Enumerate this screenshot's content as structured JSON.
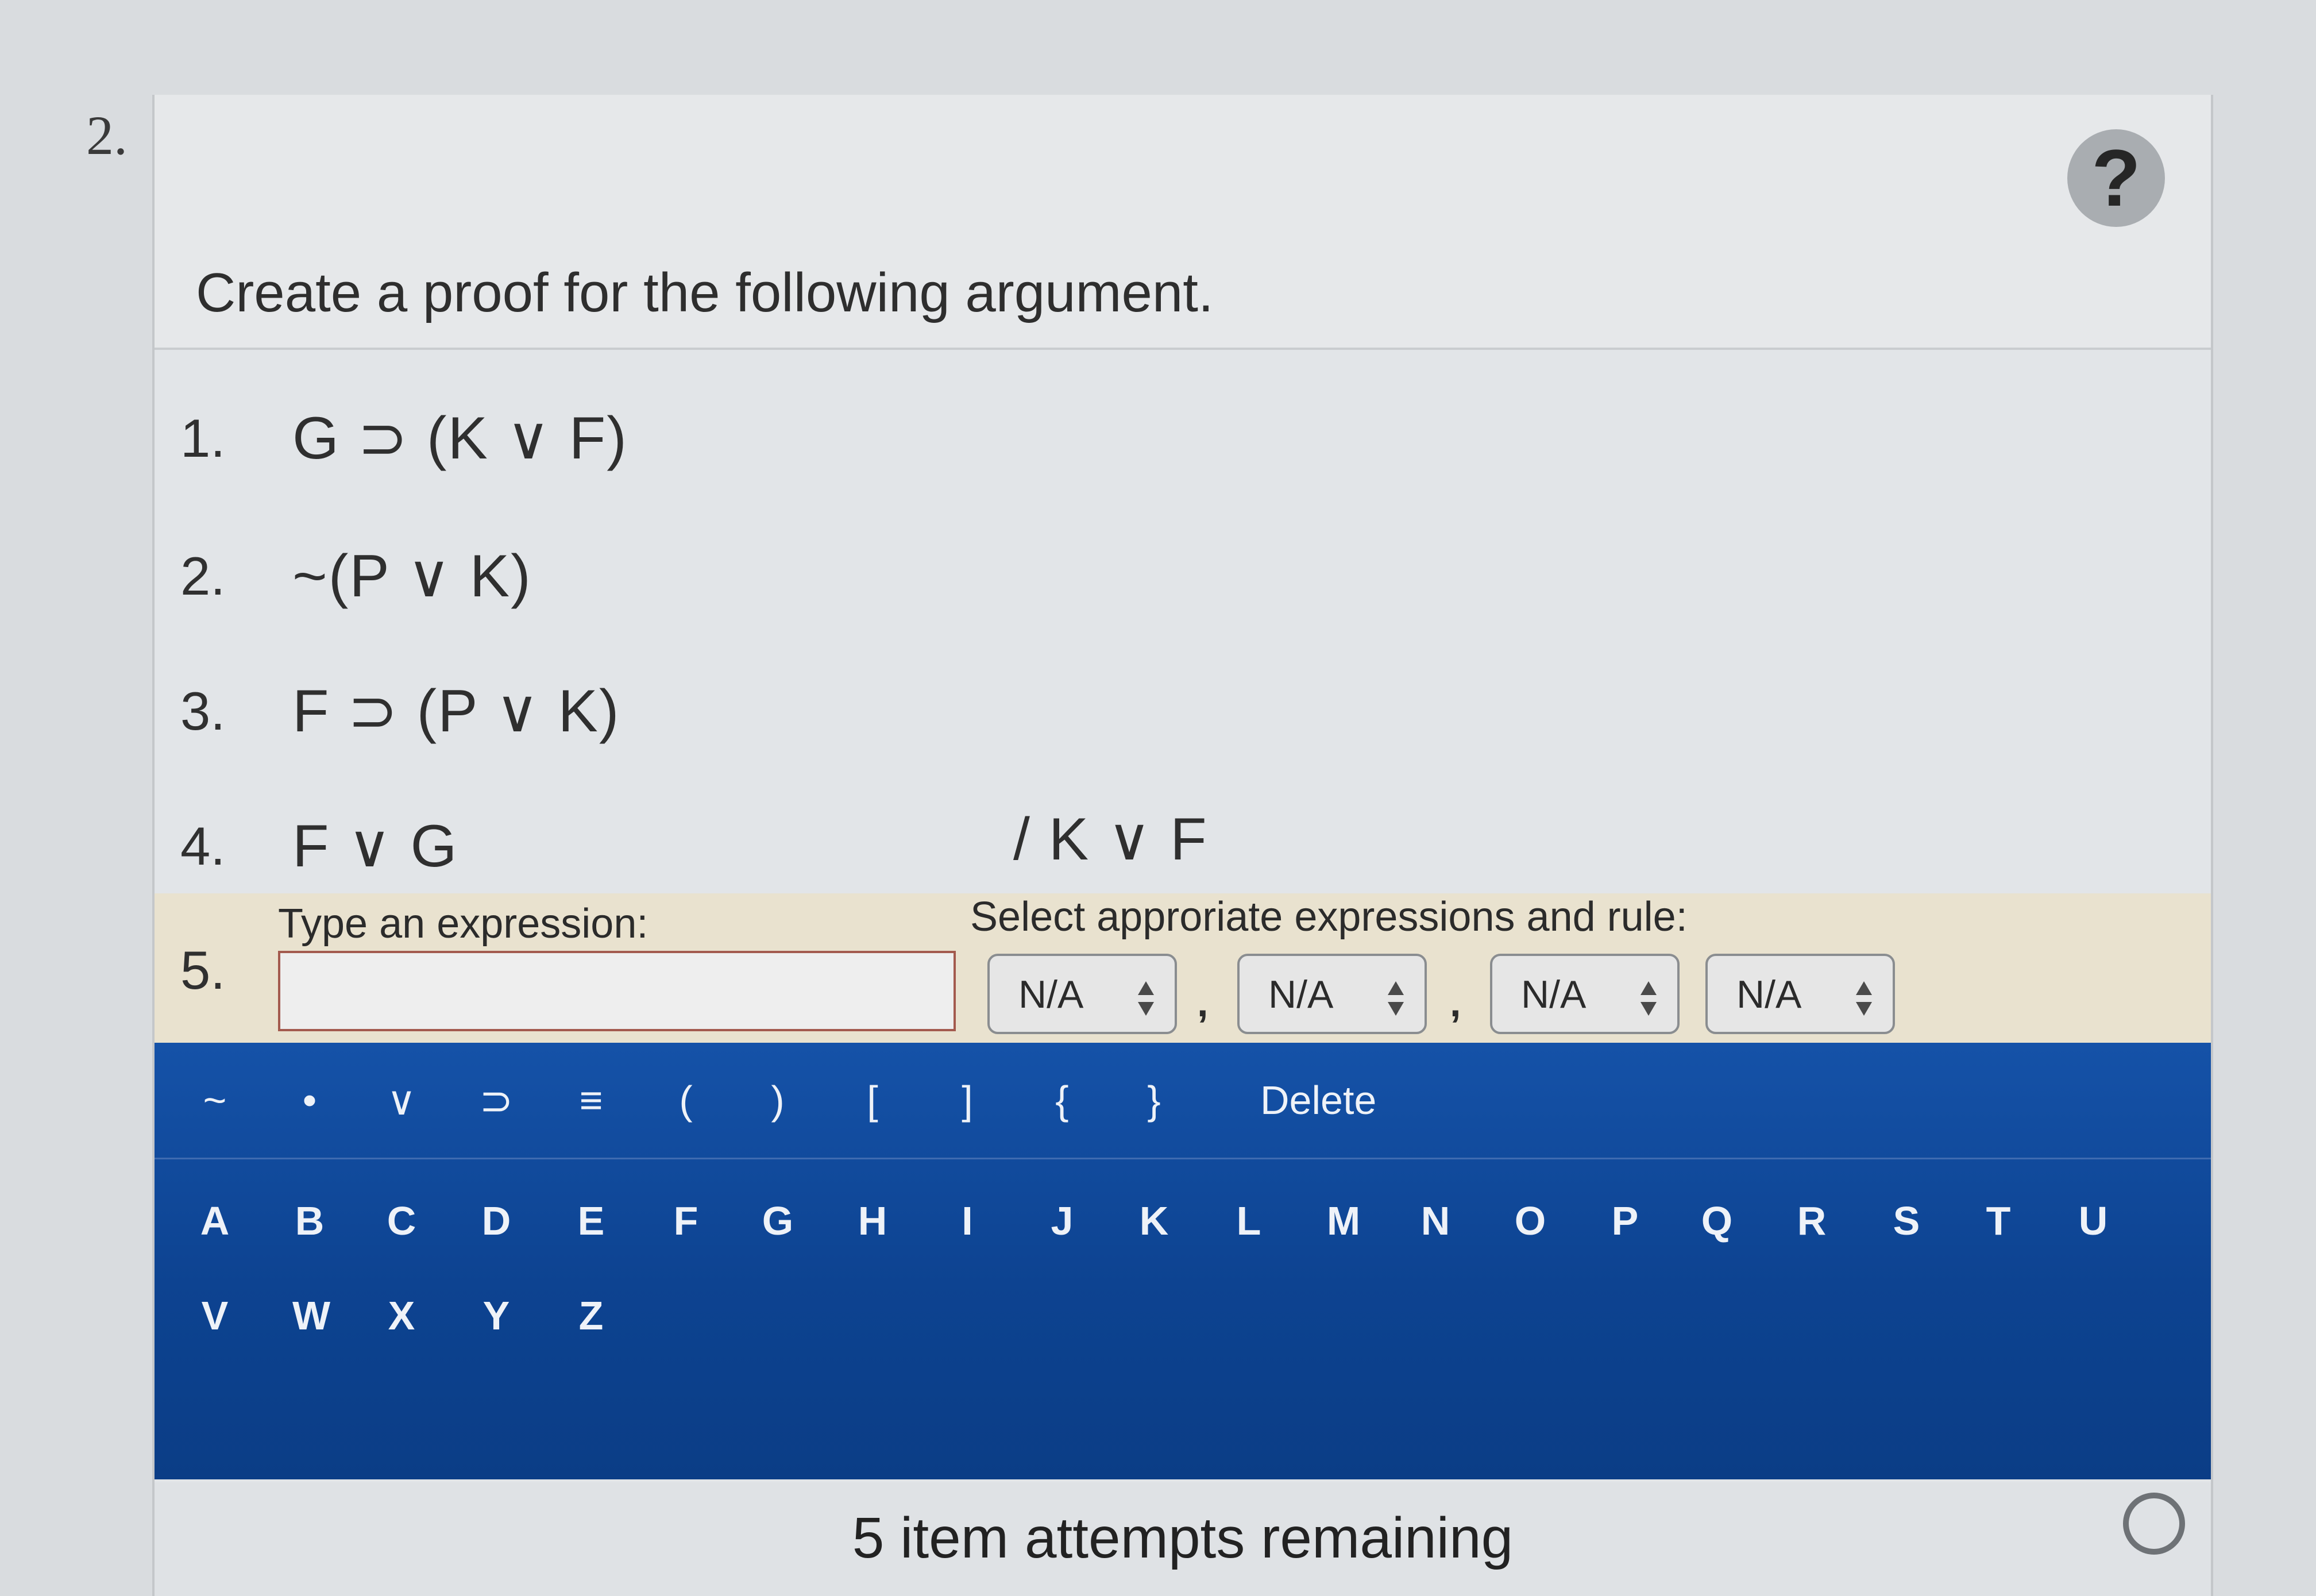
{
  "question_number": "2.",
  "help_icon": "?",
  "instruction": "Create a proof for the following argument.",
  "premises": [
    {
      "num": "1.",
      "expr": "G ⊃ (K ∨ F)"
    },
    {
      "num": "2.",
      "expr": "~(P ∨ K)"
    },
    {
      "num": "3.",
      "expr": "F ⊃ (P ∨ K)"
    },
    {
      "num": "4.",
      "expr": "F ∨ G"
    }
  ],
  "conclusion": "/ K ∨ F",
  "entry": {
    "num": "5.",
    "type_label": "Type an expression:",
    "input_value": "",
    "select_label": "Select approriate expressions and rule:",
    "selects": [
      "N/A",
      "N/A",
      "N/A",
      "N/A"
    ],
    "separator": ","
  },
  "keyboard": {
    "symbols": [
      "~",
      "•",
      "∨",
      "⊃",
      "≡",
      "(",
      ")",
      "[",
      "]",
      "{",
      "}"
    ],
    "delete_label": "Delete",
    "letters_row1": [
      "A",
      "B",
      "C",
      "D",
      "E",
      "F",
      "G",
      "H",
      "I",
      "J",
      "K",
      "L",
      "M",
      "N",
      "O",
      "P",
      "Q",
      "R",
      "S",
      "T",
      "U"
    ],
    "letters_row2": [
      "V",
      "W",
      "X",
      "Y",
      "Z"
    ]
  },
  "footer": {
    "attempts_text": "5 item attempts remaining"
  },
  "colors": {
    "keyboard_bg": "#0f4592",
    "entry_row_bg": "#e9e2cf",
    "input_border": "#a35a4e"
  }
}
